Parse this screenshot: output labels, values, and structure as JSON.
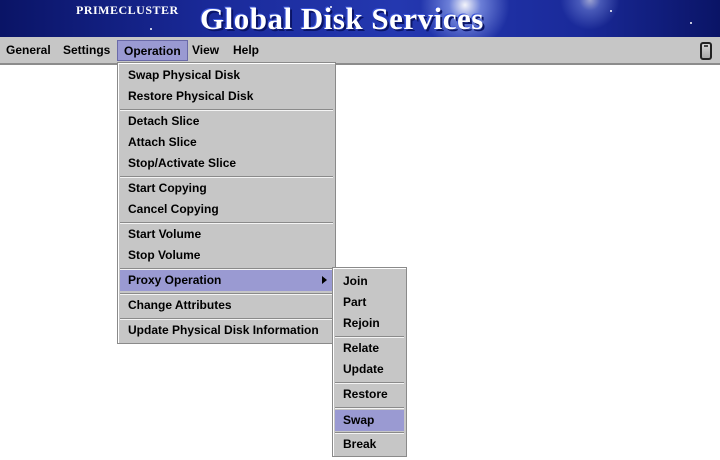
{
  "banner": {
    "brand": "PRIMECLUSTER",
    "title": "Global Disk Services"
  },
  "menubar": {
    "items": [
      {
        "label": "General"
      },
      {
        "label": "Settings"
      },
      {
        "label": "Operation",
        "active": true
      },
      {
        "label": "View"
      },
      {
        "label": "Help"
      }
    ],
    "trash_icon": "trash-can-icon"
  },
  "operation_menu": {
    "items": [
      {
        "label": "Swap Physical Disk"
      },
      {
        "label": "Restore Physical Disk"
      },
      {
        "label": "Detach Slice"
      },
      {
        "label": "Attach Slice"
      },
      {
        "label": "Stop/Activate Slice"
      },
      {
        "label": "Start Copying"
      },
      {
        "label": "Cancel Copying"
      },
      {
        "label": "Start Volume"
      },
      {
        "label": "Stop Volume"
      },
      {
        "label": "Proxy Operation",
        "submenu": true,
        "active": true
      },
      {
        "label": "Change Attributes"
      },
      {
        "label": "Update Physical Disk Information"
      }
    ]
  },
  "proxy_menu": {
    "items": [
      {
        "label": "Join"
      },
      {
        "label": "Part"
      },
      {
        "label": "Rejoin"
      },
      {
        "label": "Relate"
      },
      {
        "label": "Update"
      },
      {
        "label": "Restore"
      },
      {
        "label": "Swap",
        "active": true
      },
      {
        "label": "Break"
      }
    ]
  },
  "colors": {
    "menu_bg": "#c6c6c6",
    "highlight": "#9a9ad2",
    "banner_bg": "#1a2a9a"
  }
}
